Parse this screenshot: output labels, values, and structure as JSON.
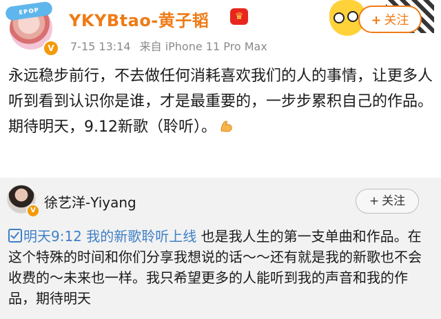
{
  "post": {
    "avatar_logo_text": "ᴇᴘᴏᴘ",
    "username": "YKYBtao-黄子韬",
    "crown_icon": "crown-badge-icon",
    "time": "7-15 13:14",
    "source": "来自 iPhone 11 Pro Max",
    "follow_label": "关注",
    "text_part1": "永远稳步前行，不去做任何消耗喜欢我们的人的事情，让更多人听到看到认识你是谁，才是最重要的，一步步累积自己的作品。期待明天，9.12新歌（聆听）。",
    "emoji_icon": "flexed-biceps-icon"
  },
  "repost": {
    "username": "徐艺洋-Yiyang",
    "follow_label": "关注",
    "link_text": "明天9:12 我的新歌聆听上线",
    "body_text": "  也是我人生的第一支单曲和作品。在这个特殊的时间和你们分享我想说的话～～还有就是我的新歌也不会收费的～未来也一样。我只希望更多的人能听到我的声音和我的作品，期待明天"
  },
  "colors": {
    "brand_orange": "#ef7b16",
    "link_blue": "#3f7fc7",
    "verified_badge": "#f39a0c",
    "repost_bg": "#f2f2f2"
  }
}
